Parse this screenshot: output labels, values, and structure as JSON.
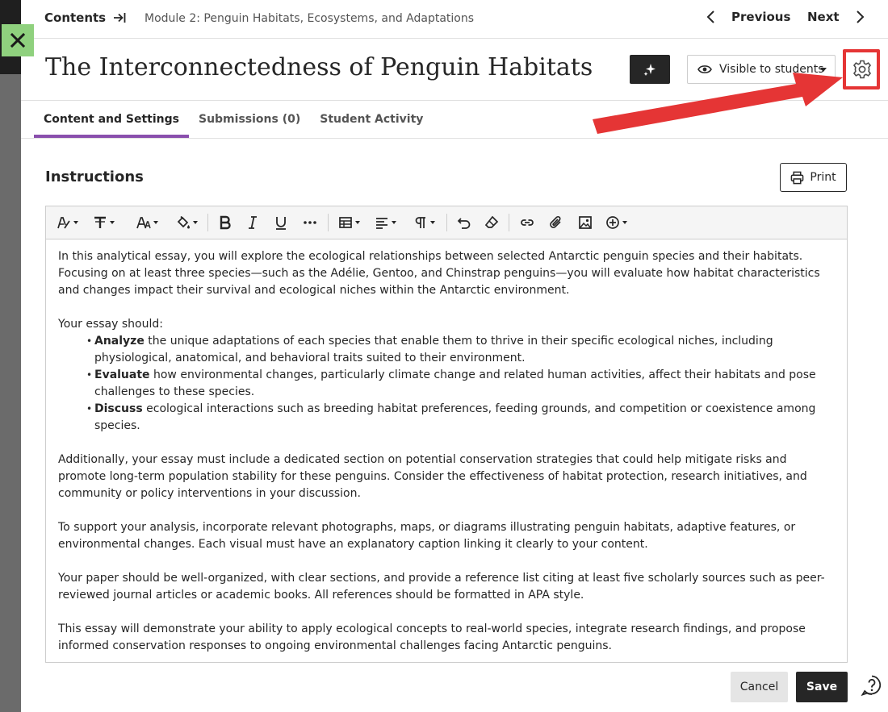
{
  "nav": {
    "contents_label": "Contents",
    "breadcrumb": "Module 2: Penguin Habitats, Ecosystems, and Adaptations",
    "previous_label": "Previous",
    "next_label": "Next"
  },
  "header": {
    "title": "The Interconnectedness of Penguin Habitats ...",
    "visibility_label": "Visible to students",
    "icons": [
      "close-icon",
      "arrow-to-line-icon",
      "chevron-left-icon",
      "chevron-right-icon",
      "sparkle-icon",
      "eye-icon",
      "gear-icon"
    ]
  },
  "tabs": [
    {
      "label": "Content and Settings",
      "active": true
    },
    {
      "label": "Submissions (0)",
      "active": false
    },
    {
      "label": "Student Activity",
      "active": false
    }
  ],
  "instructions": {
    "heading": "Instructions",
    "print_label": "Print"
  },
  "editor": {
    "toolbar_icons": [
      "text-style-icon",
      "format-icon",
      "font-size-icon",
      "color-fill-icon",
      "bold-icon",
      "italic-icon",
      "underline-icon",
      "more-icon",
      "table-icon",
      "align-icon",
      "paragraph-icon",
      "undo-icon",
      "eraser-icon",
      "link-icon",
      "attachment-icon",
      "image-icon",
      "add-content-icon"
    ],
    "p1": "In this analytical essay, you will explore the ecological relationships between selected Antarctic penguin species and their habitats. Focusing on at least three species—such as the Adélie, Gentoo, and Chinstrap penguins—you will evaluate how habitat characteristics and changes impact their survival and ecological niches within the Antarctic environment.",
    "p2_lead": "Your essay should:",
    "bullets": [
      {
        "bold": "Analyze",
        "text": " the unique adaptations of each species that enable them to thrive in their specific ecological niches, including physiological, anatomical, and behavioral traits suited to their environment."
      },
      {
        "bold": "Evaluate",
        "text": " how environmental changes, particularly climate change and related human activities, affect their habitats and pose challenges to these species."
      },
      {
        "bold": "Discuss",
        "text": " ecological interactions such as breeding habitat preferences, feeding grounds, and competition or coexistence among species."
      }
    ],
    "p3": "Additionally, your essay must include a dedicated section on potential conservation strategies that could help mitigate risks and promote long-term population stability for these penguins. Consider the effectiveness of habitat protection, research initiatives, and community or policy interventions in your discussion.",
    "p4": "To support your analysis, incorporate relevant photographs, maps, or diagrams illustrating penguin habitats, adaptive features, or environmental changes. Each visual must have an explanatory caption linking it clearly to your content.",
    "p5": "Your paper should be well-organized, with clear sections, and provide a reference list citing at least five scholarly sources such as peer-reviewed journal articles or academic books. All references should be formatted in APA style.",
    "p6": "This essay will demonstrate your ability to apply ecological concepts to real-world species, integrate research findings, and propose informed conservation responses to ongoing environmental challenges facing Antarctic penguins."
  },
  "footer": {
    "cancel_label": "Cancel",
    "save_label": "Save"
  },
  "colors": {
    "close_button": "#8fd17e",
    "active_tab": "#8a4fad",
    "highlight": "#e53535",
    "primary_button": "#262626"
  }
}
